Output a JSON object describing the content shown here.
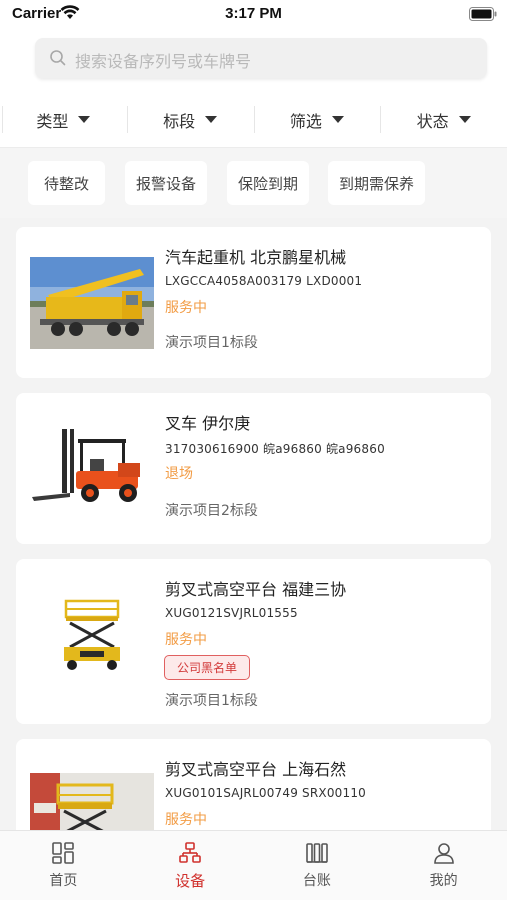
{
  "status_bar": {
    "carrier": "Carrier",
    "time": "3:17 PM"
  },
  "search": {
    "placeholder": "搜索设备序列号或车牌号"
  },
  "filters": [
    {
      "label": "类型"
    },
    {
      "label": "标段"
    },
    {
      "label": "筛选"
    },
    {
      "label": "状态"
    }
  ],
  "quick_tags": [
    "待整改",
    "报警设备",
    "保险到期",
    "到期需保养"
  ],
  "equipment": [
    {
      "title": "汽车起重机  北京鹏星机械",
      "serial": "LXGCCA4058A003179  LXD0001",
      "status": "服务中",
      "project": "演示项目1标段",
      "image_icon": "crane-truck-photo"
    },
    {
      "title": "叉车  伊尔庚",
      "serial": "317030616900  皖a96860  皖a96860",
      "status": "退场",
      "project": "演示项目2标段",
      "image_icon": "forklift-photo"
    },
    {
      "title": "剪叉式高空平台  福建三协",
      "serial": "XUG0121SVJRL01555",
      "status": "服务中",
      "badge": "公司黑名单",
      "project": "演示项目1标段",
      "image_icon": "scissor-lift-photo"
    },
    {
      "title": "剪叉式高空平台  上海石然",
      "serial": "XUG0101SAJRL00749  SRX00110",
      "status": "服务中",
      "image_icon": "scissor-lift-warehouse-photo"
    }
  ],
  "tab_bar": {
    "tabs": [
      {
        "label": "首页",
        "icon": "home-grid-icon"
      },
      {
        "label": "设备",
        "icon": "equipment-icon"
      },
      {
        "label": "台账",
        "icon": "ledger-icon"
      },
      {
        "label": "我的",
        "icon": "profile-icon"
      }
    ],
    "active": "设备",
    "active_color": "#d0312d"
  },
  "colors": {
    "status_orange": "#f29c45",
    "badge_red": "#d23b3b"
  }
}
